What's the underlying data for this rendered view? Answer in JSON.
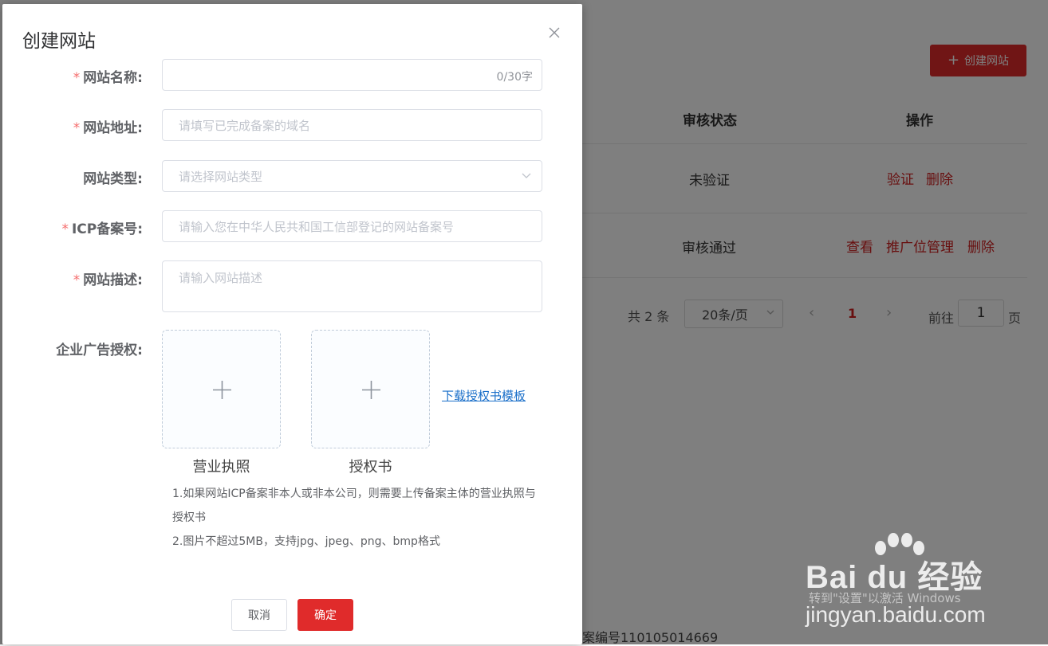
{
  "background": {
    "create_button": {
      "icon": "plus-icon",
      "label": "创建网站"
    },
    "table": {
      "headers": {
        "status": "审核状态",
        "actions": "操作"
      },
      "rows": [
        {
          "status": "未验证",
          "actions": [
            "验证",
            "删除"
          ]
        },
        {
          "status": "审核通过",
          "actions": [
            "查看",
            "推广位管理",
            "删除"
          ]
        }
      ]
    },
    "pagination": {
      "total": "共 2 条",
      "page_size": "20条/页",
      "current_page": "1",
      "goto_label": "前往",
      "goto_value": "1",
      "goto_unit": "页"
    },
    "footer": "案编号110105014669",
    "watermark": {
      "logo": "Bai du 经验",
      "activation_notice": "转到\"设置\"以激活 Windows",
      "url": "jingyan.baidu.com"
    }
  },
  "dialog": {
    "title": "创建网站",
    "fields": {
      "site_name": {
        "label": "网站名称:",
        "value": "",
        "counter": "0/30字",
        "required": "*"
      },
      "site_url": {
        "label": "网站地址:",
        "placeholder": "请填写已完成备案的域名",
        "required": "*"
      },
      "site_type": {
        "label": "网站类型:",
        "placeholder": "请选择网站类型"
      },
      "icp": {
        "label": "ICP备案号:",
        "placeholder": "请输入您在中华人民共和国工信部登记的网站备案号",
        "required": "*"
      },
      "description": {
        "label": "网站描述:",
        "placeholder": "请输入网站描述",
        "required": "*"
      },
      "authorization": {
        "label": "企业广告授权:"
      }
    },
    "uploads": [
      {
        "caption": "营业执照"
      },
      {
        "caption": "授权书"
      }
    ],
    "download_link": "下载授权书模板",
    "notes": [
      "1.如果网站ICP备案非本人或非本公司，则需要上传备案主体的营业执照与授权书",
      "2.图片不超过5MB，支持jpg、jpeg、png、bmp格式"
    ],
    "buttons": {
      "cancel": "取消",
      "confirm": "确定"
    }
  },
  "colors": {
    "accent": "#e02b2b",
    "link": "#1a6fc9",
    "required": "#f56c6c"
  }
}
